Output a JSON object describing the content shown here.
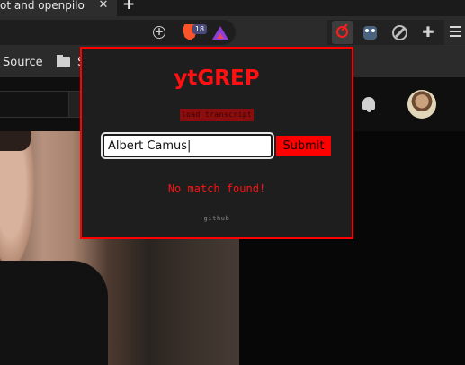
{
  "browser": {
    "tab": {
      "title": "ot and openpilo",
      "close_glyph": "✕"
    },
    "new_tab_glyph": "+",
    "toolbar": {
      "zoom_glyph": "+",
      "brave_shield_count": "18"
    },
    "bookmarks": [
      {
        "label": "Source"
      },
      {
        "label": "S"
      }
    ]
  },
  "popup": {
    "title": "ytGREP",
    "load_transcript_label": "load transcript",
    "search": {
      "value": "Albert Camus|"
    },
    "submit_label": "Submit",
    "result_message": "No match found!",
    "footer_link": "github"
  },
  "colors": {
    "accent": "#ff0000",
    "popup_bg": "#1e1e1e",
    "page_bg": "#0f0f0f"
  }
}
